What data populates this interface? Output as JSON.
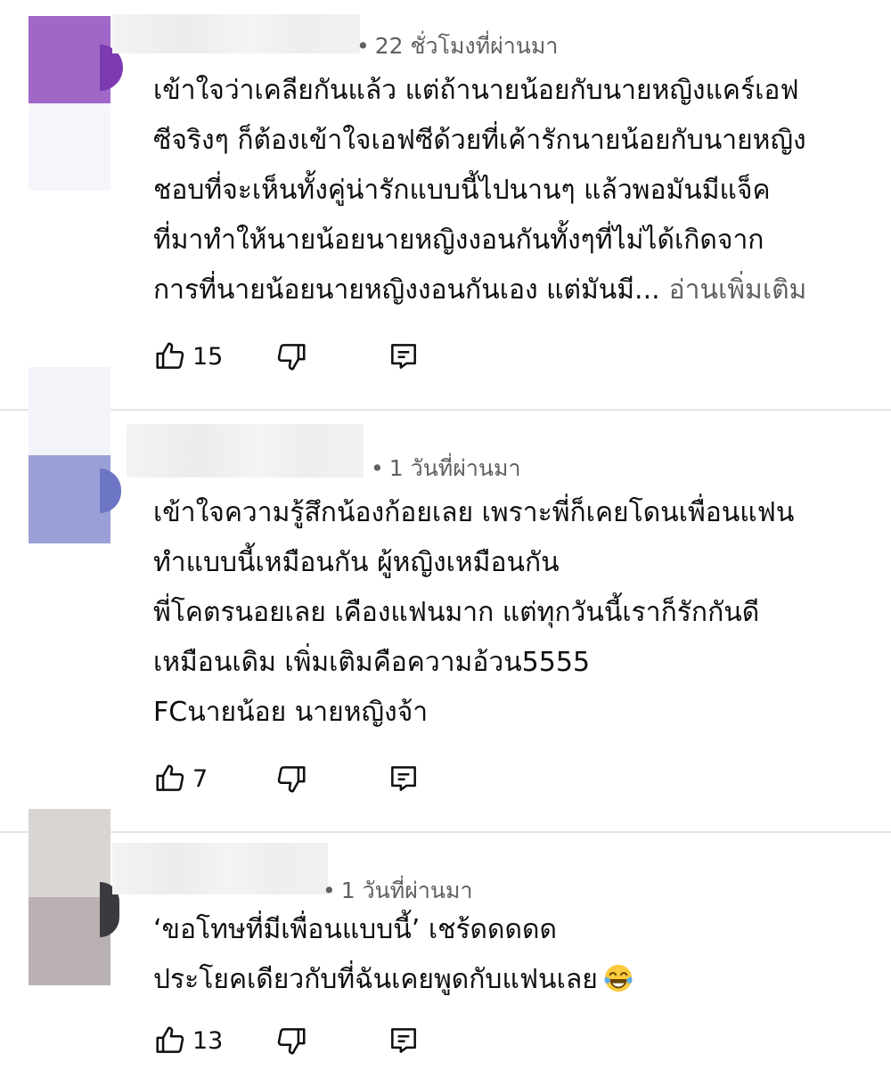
{
  "comments": [
    {
      "time": "22 ชั่วโมงที่ผ่านมา",
      "lines": [
        "เข้าใจว่าเคลียกันแล้ว แต่ถ้านายน้อยกับนายหญิงแคร์เอฟ",
        "ซีจริงๆ ก็ต้องเข้าใจเอฟซีด้วยที่เค้ารักนายน้อยกับนายหญิง",
        "ชอบที่จะเห็นทั้งคู่น่ารักแบบนี้ไปนานๆ แล้วพอมันมีแจ็ค",
        "ที่มาทำให้นายน้อยนายหญิงงอนกันทั้งๆที่ไม่ได้เกิดจาก",
        "การที่นายน้อยนายหญิงงอนกันเอง แต่มันมี..."
      ],
      "read_more": "อ่านเพิ่มเติม",
      "likes": "15"
    },
    {
      "time": "1 วันที่ผ่านมา",
      "lines": [
        "เข้าใจความรู้สึกน้องก้อยเลย เพราะพี่ก็เคยโดนเพื่อนแฟน",
        "ทำแบบนี้เหมือนกัน ผู้หญิงเหมือนกัน",
        "พี่โคตรนอยเลย เคืองแฟนมาก แต่ทุกวันนี้เราก็รักกันดี",
        "เหมือนเดิม เพิ่มเติมคือความอ้วน5555",
        "FCนายน้อย นายหญิงจ้า"
      ],
      "likes": "7"
    },
    {
      "time": "1 วันที่ผ่านมา",
      "lines": [
        "‘ขอโทษที่มีเพื่อนแบบนี้’ เชร้ดดดดด",
        "ประโยคเดียวกับที่ฉันเคยพูดกับแฟนเลย"
      ],
      "emoji": "face-with-tears-of-joy",
      "likes": "13"
    }
  ],
  "dot": "•",
  "colors": {
    "text": "#0f0f0f",
    "meta": "#606060",
    "divider": "#e5e5e5",
    "avatar1": "#a066c8",
    "avatar2": "#9aa0d6",
    "avatar3": "#b9b1b1"
  }
}
